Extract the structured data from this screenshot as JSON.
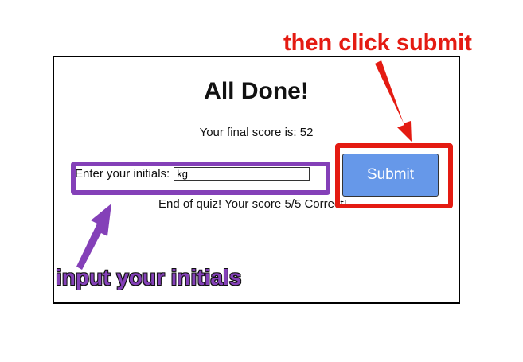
{
  "quiz": {
    "title": "All Done!",
    "final_score_text": "Your final score is: 52",
    "initials_label": "Enter your initials:",
    "initials_value": "kg",
    "submit_label": "Submit",
    "end_message": "End of quiz! Your score 5/5 Correct!"
  },
  "annotations": {
    "submit_hint": "then click submit",
    "initials_hint": "input your initials",
    "submit_hint_color": "#e41b12",
    "initials_hint_color": "#8440b8"
  },
  "colors": {
    "submit_button": "#6698e9"
  }
}
